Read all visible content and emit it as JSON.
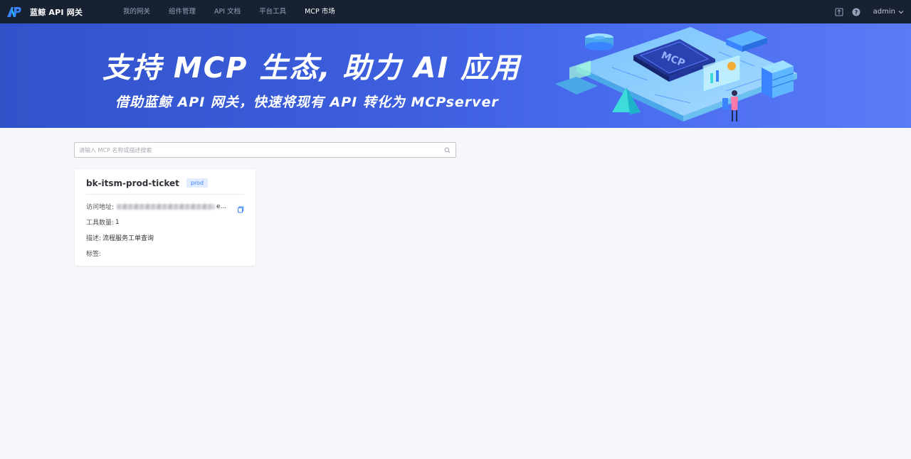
{
  "nav": {
    "brand": "蓝鲸 API 网关",
    "items": [
      {
        "label": "我的网关",
        "active": false
      },
      {
        "label": "组件管理",
        "active": false
      },
      {
        "label": "API 文档",
        "active": false
      },
      {
        "label": "平台工具",
        "active": false
      },
      {
        "label": "MCP 市场",
        "active": true
      }
    ],
    "icons": [
      "pin-icon",
      "help-icon"
    ],
    "user": "admin"
  },
  "banner": {
    "title": "支持 MCP 生态, 助力 AI 应用",
    "subtitle": "借助蓝鲸 API 网关，快速将现有 API 转化为 MCPserver",
    "art_label": "MCP"
  },
  "search": {
    "placeholder": "请输入 MCP 名称或描述搜索",
    "value": ""
  },
  "cards": [
    {
      "title": "bk-itsm-prod-ticket",
      "tag": "prod",
      "url_label": "访问地址:",
      "url_suffix": "e...",
      "tools_label": "工具数量:",
      "tools_count": "1",
      "desc_label": "描述:",
      "desc": "流程服务工单查询",
      "tags_label": "标签:"
    }
  ],
  "colors": {
    "nav_bg": "#182132",
    "banner_start": "#3152c9",
    "banner_end": "#5a7bf5",
    "accent": "#3a84ff",
    "page_bg": "#f5f7fa"
  }
}
